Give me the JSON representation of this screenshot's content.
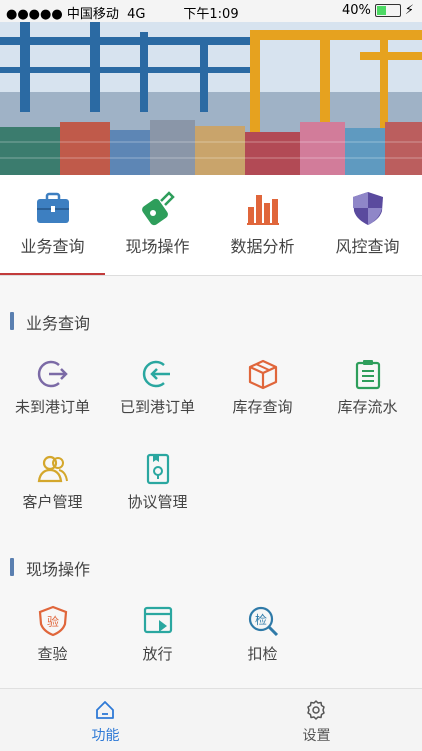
{
  "status_bar": {
    "carrier": "●●●●● 中国移动",
    "network": "4G",
    "time": "下午1:09",
    "battery": "40%"
  },
  "top_tabs": [
    {
      "label": "业务查询",
      "icon": "briefcase-icon",
      "color": "#3d7fc1",
      "active": true
    },
    {
      "label": "现场操作",
      "icon": "scan-device-icon",
      "color": "#2e9e5b"
    },
    {
      "label": "数据分析",
      "icon": "bar-chart-icon",
      "color": "#e0663b"
    },
    {
      "label": "风控查询",
      "icon": "shield-icon",
      "color": "#5a4a9e"
    }
  ],
  "sections": [
    {
      "title": "业务查询",
      "items": [
        {
          "label": "未到港订单",
          "icon": "logout-icon",
          "color": "#7b6aa6"
        },
        {
          "label": "已到港订单",
          "icon": "login-icon",
          "color": "#2aa7a0"
        },
        {
          "label": "库存查询",
          "icon": "box-icon",
          "color": "#e0663b"
        },
        {
          "label": "库存流水",
          "icon": "clipboard-list-icon",
          "color": "#2e9e5b"
        },
        {
          "label": "客户管理",
          "icon": "users-icon",
          "color": "#d4a72c"
        },
        {
          "label": "协议管理",
          "icon": "agreement-icon",
          "color": "#2aa7a0"
        }
      ]
    },
    {
      "title": "现场操作",
      "items": [
        {
          "label": "查验",
          "icon": "inspect-badge-icon",
          "color": "#e0663b",
          "glyph": "验"
        },
        {
          "label": "放行",
          "icon": "release-icon",
          "color": "#2aa7a0"
        },
        {
          "label": "扣检",
          "icon": "search-check-icon",
          "color": "#2f7aa8",
          "glyph": "检"
        }
      ]
    }
  ],
  "bottom_nav": [
    {
      "label": "功能",
      "icon": "home-icon",
      "active": true,
      "color": "#2f7ad6"
    },
    {
      "label": "设置",
      "icon": "gear-icon",
      "active": false,
      "color": "#555555"
    }
  ]
}
